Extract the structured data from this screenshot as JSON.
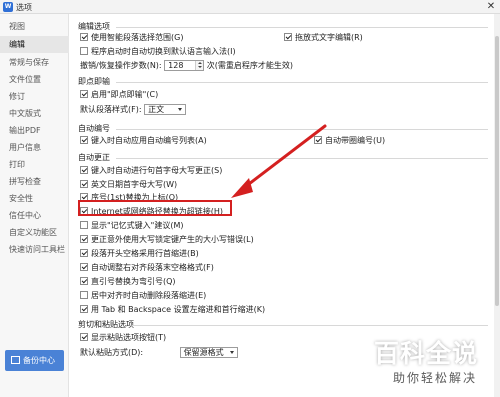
{
  "window": {
    "title": "选项",
    "close": "✕",
    "app_icon": "W"
  },
  "sidebar": {
    "items": [
      "视图",
      "编辑",
      "常规与保存",
      "文件位置",
      "修订",
      "中文版式",
      "输出PDF",
      "用户信息",
      "打印",
      "拼写检查",
      "安全性",
      "信任中心",
      "自定义功能区",
      "快速访问工具栏"
    ],
    "active_index": 1,
    "backup_label": "备份中心"
  },
  "sections": {
    "edit_options": {
      "title": "编辑选项",
      "smart_select": "使用智能段落选择范围(G)",
      "drag_edit": "拖放式文字编辑(R)",
      "ime_switch": "程序启动时自动切换到默认语言输入法(I)",
      "undo_steps_label": "撤销/恢复操作步数(N):",
      "undo_steps_value": "128",
      "undo_steps_note": "次(需重启程序才能生效)"
    },
    "click_type": {
      "title": "即点即输",
      "enable": "启用\"即点即输\"(C)",
      "default_style_label": "默认段落样式(F):",
      "default_style_value": "正文"
    },
    "auto_number": {
      "title": "自动编号",
      "auto_list": "键入时自动应用自动编号列表(A)",
      "auto_circle": "自动带圈编号(U)"
    },
    "autocorrect": {
      "title": "自动更正",
      "items": [
        "键入时自动进行句首字母大写更正(S)",
        "英文日期首字母大写(W)",
        "序号(1st)替换为上标(O)",
        "Internet或网络路径替换为超链接(H)",
        "显示\"记忆式键入\"建议(M)",
        "更正意外使用大写锁定键产生的大小写错误(L)",
        "段落开头空格采用行首缩进(B)",
        "自动调整右对齐段落末空格格式(F)",
        "直引号替换为弯引号(Q)",
        "居中对齐时自动删除段落缩进(E)",
        "用 Tab 和 Backspace 设置左缩进和首行缩进(K)"
      ],
      "checked": [
        true,
        true,
        true,
        true,
        false,
        true,
        true,
        true,
        true,
        false,
        true
      ]
    },
    "clipboard": {
      "title": "剪切和粘贴选项",
      "show_paste_button": "显示粘贴选项按钮(T)",
      "default_paste_label": "默认粘贴方式(D):",
      "default_paste_value": "保留源格式"
    }
  },
  "annotation": {
    "color": "#d42020"
  },
  "watermark": {
    "main": "百科全说",
    "sub": "助你轻松解决"
  }
}
